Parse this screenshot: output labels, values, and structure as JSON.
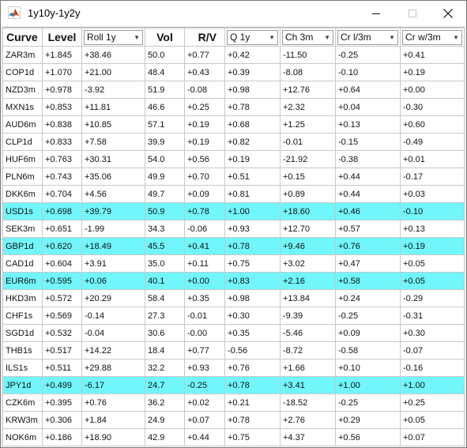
{
  "window": {
    "title": "1y10y-1y2y",
    "icon": "matlab-icon"
  },
  "columns": [
    {
      "label": "Curve",
      "type": "plain",
      "align": "left"
    },
    {
      "label": "Level",
      "type": "plain",
      "align": "center"
    },
    {
      "label": "Roll 1y",
      "type": "dropdown"
    },
    {
      "label": "Vol",
      "type": "plain",
      "align": "center"
    },
    {
      "label": "R/V",
      "type": "plain",
      "align": "right"
    },
    {
      "label": "Q 1y",
      "type": "dropdown"
    },
    {
      "label": "Ch 3m",
      "type": "dropdown"
    },
    {
      "label": "Cr l/3m",
      "type": "dropdown"
    },
    {
      "label": "Cr w/3m",
      "type": "dropdown"
    }
  ],
  "highlight_color": "#70f6fb",
  "rows": [
    {
      "cells": [
        "ZAR3m",
        "+1.845",
        "+38.46",
        "50.0",
        "+0.77",
        "+0.42",
        "-11.50",
        "-0.25",
        "+0.41"
      ],
      "highlight": false
    },
    {
      "cells": [
        "COP1d",
        "+1.070",
        "+21.00",
        "48.4",
        "+0.43",
        "+0.39",
        "-8.08",
        "-0.10",
        "+0.19"
      ],
      "highlight": false
    },
    {
      "cells": [
        "NZD3m",
        "+0.978",
        "-3.92",
        "51.9",
        "-0.08",
        "+0.98",
        "+12.76",
        "+0.64",
        "+0.00"
      ],
      "highlight": false
    },
    {
      "cells": [
        "MXN1s",
        "+0.853",
        "+11.81",
        "46.6",
        "+0.25",
        "+0.78",
        "+2.32",
        "+0.04",
        "-0.30"
      ],
      "highlight": false
    },
    {
      "cells": [
        "AUD6m",
        "+0.838",
        "+10.85",
        "57.1",
        "+0.19",
        "+0.68",
        "+1.25",
        "+0.13",
        "+0.60"
      ],
      "highlight": false
    },
    {
      "cells": [
        "CLP1d",
        "+0.833",
        "+7.58",
        "39.9",
        "+0.19",
        "+0.82",
        "-0.01",
        "-0.15",
        "-0.49"
      ],
      "highlight": false
    },
    {
      "cells": [
        "HUF6m",
        "+0.763",
        "+30.31",
        "54.0",
        "+0.56",
        "+0.19",
        "-21.92",
        "-0.38",
        "+0.01"
      ],
      "highlight": false
    },
    {
      "cells": [
        "PLN6m",
        "+0.743",
        "+35.06",
        "49.9",
        "+0.70",
        "+0.51",
        "+0.15",
        "+0.44",
        "-0.17"
      ],
      "highlight": false
    },
    {
      "cells": [
        "DKK6m",
        "+0.704",
        "+4.56",
        "49.7",
        "+0.09",
        "+0.81",
        "+0.89",
        "+0.44",
        "+0.03"
      ],
      "highlight": false
    },
    {
      "cells": [
        "USD1s",
        "+0.698",
        "+39.79",
        "50.9",
        "+0.78",
        "+1.00",
        "+18.60",
        "+0.46",
        "-0.10"
      ],
      "highlight": true
    },
    {
      "cells": [
        "SEK3m",
        "+0.651",
        "-1.99",
        "34.3",
        "-0.06",
        "+0.93",
        "+12.70",
        "+0.57",
        "+0.13"
      ],
      "highlight": false
    },
    {
      "cells": [
        "GBP1d",
        "+0.620",
        "+18.49",
        "45.5",
        "+0.41",
        "+0.78",
        "+9.46",
        "+0.76",
        "+0.19"
      ],
      "highlight": true
    },
    {
      "cells": [
        "CAD1d",
        "+0.604",
        "+3.91",
        "35.0",
        "+0.11",
        "+0.75",
        "+3.02",
        "+0.47",
        "+0.05"
      ],
      "highlight": false
    },
    {
      "cells": [
        "EUR6m",
        "+0.595",
        "+0.06",
        "40.1",
        "+0.00",
        "+0.83",
        "+2.16",
        "+0.58",
        "+0.05"
      ],
      "highlight": true
    },
    {
      "cells": [
        "HKD3m",
        "+0.572",
        "+20.29",
        "58.4",
        "+0.35",
        "+0.98",
        "+13.84",
        "+0.24",
        "-0.29"
      ],
      "highlight": false
    },
    {
      "cells": [
        "CHF1s",
        "+0.569",
        "-0.14",
        "27.3",
        "-0.01",
        "+0.30",
        "-9.39",
        "-0.25",
        "-0.31"
      ],
      "highlight": false
    },
    {
      "cells": [
        "SGD1d",
        "+0.532",
        "-0.04",
        "30.6",
        "-0.00",
        "+0.35",
        "-5.46",
        "+0.09",
        "+0.30"
      ],
      "highlight": false
    },
    {
      "cells": [
        "THB1s",
        "+0.517",
        "+14.22",
        "18.4",
        "+0.77",
        "-0.56",
        "-8.72",
        "-0.58",
        "-0.07"
      ],
      "highlight": false
    },
    {
      "cells": [
        "ILS1s",
        "+0.511",
        "+29.88",
        "32.2",
        "+0.93",
        "+0.76",
        "+1.66",
        "+0.10",
        "-0.16"
      ],
      "highlight": false
    },
    {
      "cells": [
        "JPY1d",
        "+0.499",
        "-6.17",
        "24.7",
        "-0.25",
        "+0.78",
        "+3.41",
        "+1.00",
        "+1.00"
      ],
      "highlight": true
    },
    {
      "cells": [
        "CZK6m",
        "+0.395",
        "+0.76",
        "36.2",
        "+0.02",
        "+0.21",
        "-18.52",
        "-0.25",
        "+0.25"
      ],
      "highlight": false
    },
    {
      "cells": [
        "KRW3m",
        "+0.306",
        "+1.84",
        "24.9",
        "+0.07",
        "+0.78",
        "+2.76",
        "+0.29",
        "+0.05"
      ],
      "highlight": false
    },
    {
      "cells": [
        "NOK6m",
        "+0.186",
        "+18.90",
        "42.9",
        "+0.44",
        "+0.75",
        "+4.37",
        "+0.56",
        "+0.07"
      ],
      "highlight": false
    }
  ]
}
